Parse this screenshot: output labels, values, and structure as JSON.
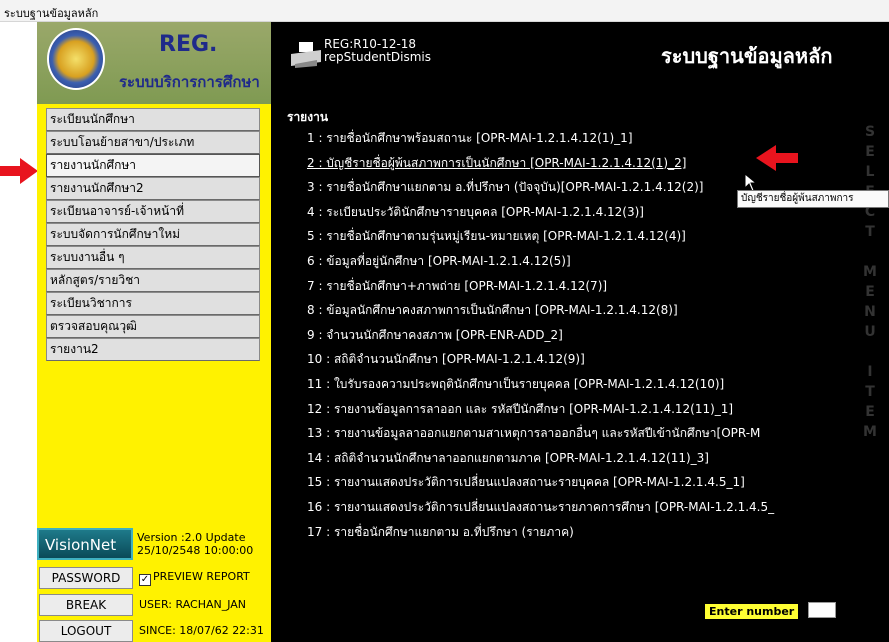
{
  "window": {
    "title": "ระบบฐานข้อมูลหลัก"
  },
  "brand": {
    "logo_text": "REG.",
    "subtitle": "ระบบบริการการศึกษา"
  },
  "menu": {
    "items": [
      {
        "label": "ระเบียนนักศึกษา"
      },
      {
        "label": "ระบบโอนย้ายสาขา/ประเภท"
      },
      {
        "label": "รายงานนักศึกษา"
      },
      {
        "label": "รายงานนักศึกษา2"
      },
      {
        "label": "ระเบียนอาจารย์-เจ้าหน้าที่"
      },
      {
        "label": "ระบบจัดการนักศึกษาใหม่"
      },
      {
        "label": "ระบบงานอื่น ๆ"
      },
      {
        "label": "หลักสูตร/รายวิชา"
      },
      {
        "label": "ระเบียนวิชาการ"
      },
      {
        "label": "ตรวจสอบคุณวุฒิ"
      },
      {
        "label": "รายงาน2"
      }
    ],
    "active_index": 2
  },
  "footer": {
    "vision_label": "VisionNet",
    "version_line1": "Version :2.0 Update",
    "version_line2": "25/10/2548 10:00:00",
    "password_label": "PASSWORD",
    "preview_label": "PREVIEW REPORT",
    "preview_checked": true,
    "break_label": "BREAK",
    "user_label": "USER: RACHAN_JAN",
    "logout_label": "LOGOUT",
    "since_label": "SINCE: 18/07/62 22:31"
  },
  "header": {
    "reg_code": "REG:R10-12-18",
    "report_name": "repStudentDismis",
    "main_title": "ระบบฐานข้อมูลหลัก"
  },
  "report": {
    "heading": "รายงาน",
    "items": [
      "1 : รายชื่อนักศึกษาพร้อมสถานะ [OPR-MAI-1.2.1.4.12(1)_1]",
      "2 : บัญชีรายชื่อผู้พ้นสภาพการเป็นนักศึกษา [OPR-MAI-1.2.1.4.12(1)_2]",
      "3 : รายชื่อนักศึกษาแยกตาม อ.ที่ปรึกษา (ปัจจุบัน)[OPR-MAI-1.2.1.4.12(2)]",
      "4 : ระเบียนประวัตินักศึกษารายบุคคล [OPR-MAI-1.2.1.4.12(3)]",
      "5 : รายชื่อนักศึกษาตามรุ่นหมู่เรียน-หมายเหตุ [OPR-MAI-1.2.1.4.12(4)]",
      "6 : ข้อมูลที่อยู่นักศึกษา [OPR-MAI-1.2.1.4.12(5)]",
      "7 : รายชื่อนักศึกษา+ภาพถ่าย [OPR-MAI-1.2.1.4.12(7)]",
      "8 : ข้อมูลนักศึกษาคงสภาพการเป็นนักศึกษา [OPR-MAI-1.2.1.4.12(8)]",
      "9 : จำนวนนักศึกษาคงสภาพ [OPR-ENR-ADD_2]",
      "10 : สถิติจำนวนนักศึกษา [OPR-MAI-1.2.1.4.12(9)]",
      "11 : ใบรับรองความประพฤตินักศึกษาเป็นรายบุคคล [OPR-MAI-1.2.1.4.12(10)]",
      "12 : รายงานข้อมูลการลาออก และ รหัสปีนักศึกษา [OPR-MAI-1.2.1.4.12(11)_1]",
      "13 : รายงานข้อมูลลาออกแยกตามสาเหตุการลาออกอื่นๆ และรหัสปีเข้านักศึกษา[OPR-M",
      "14 : สถิติจำนวนนักศึกษาลาออกแยกตามภาค [OPR-MAI-1.2.1.4.12(11)_3]",
      "15 : รายงานแสดงประวัติการเปลี่ยนแปลงสถานะรายบุคคล [OPR-MAI-1.2.1.4.5_1]",
      "16 : รายงานแสดงประวัติการเปลี่ยนแปลงสถานะรายภาคการศึกษา [OPR-MAI-1.2.1.4.5_",
      "17 : รายชื่อนักศึกษาแยกตาม อ.ที่ปรึกษา (รายภาค)"
    ],
    "highlighted_index": 1,
    "tooltip": "บัญชีรายชื่อผู้พ้นสภาพการ",
    "side_letters": [
      "S",
      "E",
      "L",
      "E",
      "C",
      "T",
      "",
      "M",
      "E",
      "N",
      "U",
      "",
      "I",
      "T",
      "E",
      "M"
    ]
  },
  "enter": {
    "label": "Enter number"
  },
  "colors": {
    "panel_yellow": "#fff200",
    "panel_black": "#000000",
    "arrow_red": "#e8141e"
  }
}
